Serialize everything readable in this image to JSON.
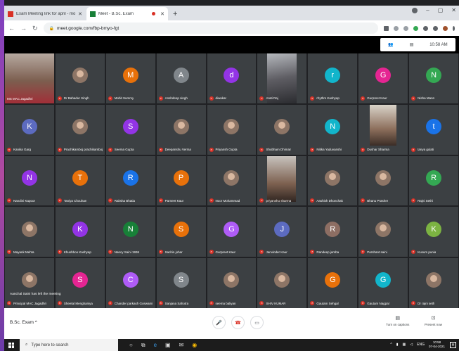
{
  "browser": {
    "tabs": [
      {
        "title": "Exam Meeting link for april - mo",
        "favicon_color": "#d93025",
        "active": false
      },
      {
        "title": "Meet - B.Sc. Exam",
        "favicon_color": "#188038",
        "active": true,
        "recording": true
      }
    ],
    "new_tab_label": "+",
    "url": "meet.google.com/fbp-bmyo-fgt",
    "window_controls": [
      "–",
      "▢",
      "✕"
    ]
  },
  "meet_top": {
    "time": "10:58 AM"
  },
  "colors": {
    "tile_bg": "#3c4043",
    "grid_bg": "#202124",
    "mic_off": "#d93025"
  },
  "participants": [
    {
      "name": "MS MAC Jagadhri",
      "kind": "video",
      "video": "teacher"
    },
    {
      "name": "Dr Bahadur Singh",
      "kind": "photo"
    },
    {
      "name": "Mohit Summy",
      "kind": "letter",
      "letter": "M",
      "color": "#e8710a"
    },
    {
      "name": "Anshdeep singh",
      "kind": "letter",
      "letter": "A",
      "color": "#80868b"
    },
    {
      "name": "diwakar",
      "kind": "letter",
      "letter": "d",
      "color": "#9334e6"
    },
    {
      "name": "Arati Raj",
      "kind": "video",
      "video": "v2"
    },
    {
      "name": "rhythm Kashyap",
      "kind": "letter",
      "letter": "r",
      "color": "#12b5cb"
    },
    {
      "name": "Gurpreet Kaur",
      "kind": "letter",
      "letter": "G",
      "color": "#e52592"
    },
    {
      "name": "Nisha Mann",
      "kind": "letter",
      "letter": "N",
      "color": "#34a853"
    },
    {
      "name": "Kanika Garg",
      "kind": "letter",
      "letter": "K",
      "color": "#5c6bc0"
    },
    {
      "name": "Prachikamboj prachikamboj",
      "kind": "photo"
    },
    {
      "name": "Seema Gupta",
      "kind": "letter",
      "letter": "S",
      "color": "#9334e6"
    },
    {
      "name": "Deepanshu Verma",
      "kind": "photo"
    },
    {
      "name": "Priyansh Gupta",
      "kind": "photo"
    },
    {
      "name": "Shubham Dhiman",
      "kind": "photo"
    },
    {
      "name": "Nitika Yaduvanshi",
      "kind": "letter",
      "letter": "N",
      "color": "#12b5cb"
    },
    {
      "name": "Dushar Sharma",
      "kind": "video",
      "video": "v3"
    },
    {
      "name": "tanya gulati",
      "kind": "letter",
      "letter": "t",
      "color": "#1a73e8"
    },
    {
      "name": "Nandini Kapoor",
      "kind": "letter",
      "letter": "N",
      "color": "#9334e6"
    },
    {
      "name": "Taniya Chouhan",
      "kind": "letter",
      "letter": "T",
      "color": "#e8710a"
    },
    {
      "name": "Raksha Bhatia",
      "kind": "letter",
      "letter": "R",
      "color": "#1a73e8"
    },
    {
      "name": "Parneet Kaur",
      "kind": "letter",
      "letter": "P",
      "color": "#e8710a"
    },
    {
      "name": "Noor Mohammad",
      "kind": "photo"
    },
    {
      "name": "priyanshu sharma",
      "kind": "video",
      "video": "v4"
    },
    {
      "name": "Aashish Dhonchak",
      "kind": "photo"
    },
    {
      "name": "Bhanu Prasher",
      "kind": "photo"
    },
    {
      "name": "Rajni Sethi",
      "kind": "letter",
      "letter": "R",
      "color": "#34a853"
    },
    {
      "name": "Mayank Mehta",
      "kind": "photo"
    },
    {
      "name": "Khushboo Kashyap",
      "kind": "letter",
      "letter": "K",
      "color": "#9334e6"
    },
    {
      "name": "Nancy Saini 1936",
      "kind": "letter",
      "letter": "N",
      "color": "#188038"
    },
    {
      "name": "Sachin johar",
      "kind": "letter",
      "letter": "S",
      "color": "#e8710a"
    },
    {
      "name": "Gurpreet Kaur",
      "kind": "letter",
      "letter": "G",
      "color": "#af5cf7"
    },
    {
      "name": "Janvinder Kaur",
      "kind": "letter",
      "letter": "J",
      "color": "#5c6bc0"
    },
    {
      "name": "Randeep jamba",
      "kind": "letter",
      "letter": "R",
      "color": "#8d6e63"
    },
    {
      "name": "Parshant saini",
      "kind": "photo"
    },
    {
      "name": "Kusum punia",
      "kind": "letter",
      "letter": "K",
      "color": "#7cb342"
    },
    {
      "name": "Principal MAC Jagadhri",
      "kind": "photo"
    },
    {
      "name": "Sheetal Menghaniya",
      "kind": "letter",
      "letter": "S",
      "color": "#e52592"
    },
    {
      "name": "Chander parkash Goswami",
      "kind": "letter",
      "letter": "C",
      "color": "#af5cf7"
    },
    {
      "name": "Sanjana Sahotra",
      "kind": "letter",
      "letter": "S",
      "color": "#80868b"
    },
    {
      "name": "seema baliyan",
      "kind": "photo"
    },
    {
      "name": "SHIV KUMAR",
      "kind": "photo"
    },
    {
      "name": "Gautam Sehgal",
      "kind": "letter",
      "letter": "G",
      "color": "#e8710a"
    },
    {
      "name": "Gautam Nagpal",
      "kind": "letter",
      "letter": "G",
      "color": "#12b5cb"
    },
    {
      "name": "Dr rajni seth",
      "kind": "photo"
    }
  ],
  "toast": "Aanchal Saini has left the meeting",
  "bottom": {
    "meeting_name": "B.Sc. Exam",
    "captions_label": "Turn on captions",
    "present_label": "Present now"
  },
  "taskbar": {
    "search_placeholder": "Type here to search",
    "lang": "ENG",
    "time": "10:58",
    "date": "07-04-2021"
  }
}
